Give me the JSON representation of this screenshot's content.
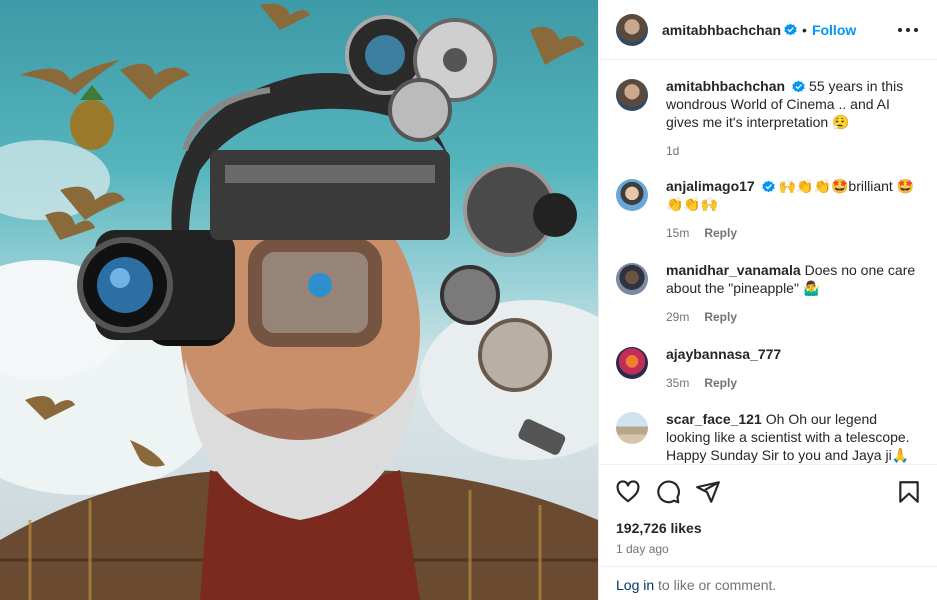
{
  "header": {
    "username": "amitabhbachchan",
    "follow_label": "Follow",
    "more_icon": "more-options-icon"
  },
  "comments": [
    {
      "username": "amitabhbachchan",
      "text": "55 years in this wondrous World of Cinema .. and AI gives me it's interpretation 😮‍💨",
      "time": "1d",
      "verified": true,
      "reply_label": ""
    },
    {
      "username": "anjalimago17",
      "text": "🙌👏👏🤩brilliant 🤩👏👏🙌",
      "time": "15m",
      "verified": true,
      "reply_label": "Reply"
    },
    {
      "username": "manidhar_vanamala",
      "text": "Does no one care about the \"pineapple\" 🤷‍♂️",
      "time": "29m",
      "verified": false,
      "reply_label": "Reply"
    },
    {
      "username": "ajaybannasa_777",
      "text": "",
      "time": "35m",
      "verified": false,
      "reply_label": "Reply"
    },
    {
      "username": "scar_face_121",
      "text": "Oh Oh our legend looking like a scientist with a telescope. Happy Sunday Sir to you and Jaya ji🙏",
      "time": "",
      "verified": false,
      "reply_label": ""
    }
  ],
  "actions": {
    "likes": "192,726 likes",
    "time_ago": "1 day ago",
    "icons": [
      "heart-icon",
      "comment-icon",
      "share-icon",
      "bookmark-icon"
    ]
  },
  "login": {
    "link_label": "Log in",
    "rest": " to like or comment."
  },
  "colors": {
    "accent": "#0095f6",
    "verified": "#0095f6",
    "muted": "#737373",
    "text": "#262626"
  }
}
